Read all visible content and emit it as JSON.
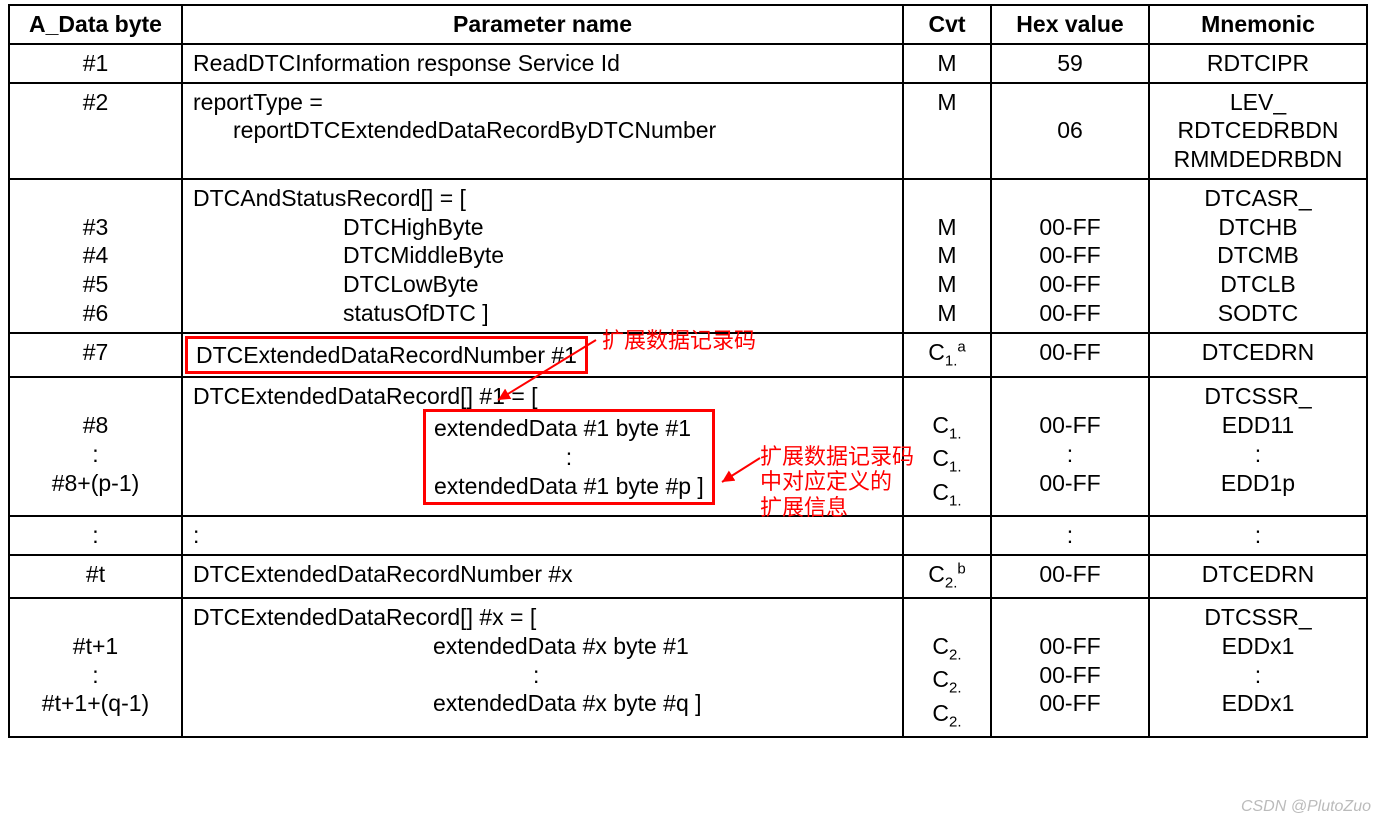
{
  "headers": {
    "col1": "A_Data byte",
    "col2": "Parameter name",
    "col3": "Cvt",
    "col4": "Hex value",
    "col5": "Mnemonic"
  },
  "rows": {
    "r1": {
      "byte": "#1",
      "param": "ReadDTCInformation response Service Id",
      "cvt": "M",
      "hex": "59",
      "mne": "RDTCIPR"
    },
    "r2": {
      "byte": "#2",
      "param_l1": "reportType =",
      "param_l2": "reportDTCExtendedDataRecordByDTCNumber",
      "cvt": "M",
      "hex": "06",
      "mne_l1": "LEV_",
      "mne_l2": "RDTCEDRBDN",
      "mne_l3": "RMMDEDRBDN"
    },
    "r3": {
      "byte_l1": "#3",
      "byte_l2": "#4",
      "byte_l3": "#5",
      "byte_l4": "#6",
      "param_l0": "DTCAndStatusRecord[] = [",
      "param_l1": "DTCHighByte",
      "param_l2": "DTCMiddleByte",
      "param_l3": "DTCLowByte",
      "param_l4": "statusOfDTC ]",
      "cvt_l1": "M",
      "cvt_l2": "M",
      "cvt_l3": "M",
      "cvt_l4": "M",
      "hex_l1": "00-FF",
      "hex_l2": "00-FF",
      "hex_l3": "00-FF",
      "hex_l4": "00-FF",
      "mne_l0": "DTCASR_",
      "mne_l1": "DTCHB",
      "mne_l2": "DTCMB",
      "mne_l3": "DTCLB",
      "mne_l4": "SODTC"
    },
    "r4": {
      "byte": "#7",
      "param": "DTCExtendedDataRecordNumber #1",
      "cvt_html": "C<span class='sub'>1.</span><span class='sup'>a</span>",
      "hex": "00-FF",
      "mne": "DTCEDRN"
    },
    "r5": {
      "byte_l1": "#8",
      "byte_l2": ":",
      "byte_l3": "#8+(p-1)",
      "param_l0": "DTCExtendedDataRecord[] #1 = [",
      "param_l1": "extendedData #1 byte #1",
      "param_l2": ":",
      "param_l3": "extendedData #1 byte #p ]",
      "cvt_l1_html": "C<span class='sub'>1.</span>",
      "cvt_l2_html": "C<span class='sub'>1.</span>",
      "cvt_l3_html": "C<span class='sub'>1.</span>",
      "hex_l1": "00-FF",
      "hex_l2": ":",
      "hex_l3": "00-FF",
      "mne_l0": "DTCSSR_",
      "mne_l1": "EDD11",
      "mne_l2": ":",
      "mne_l3": "EDD1p"
    },
    "r6": {
      "byte": ":",
      "param": ":",
      "cvt": "",
      "hex": ":",
      "mne": ":"
    },
    "r7": {
      "byte": "#t",
      "param": "DTCExtendedDataRecordNumber #x",
      "cvt_html": "C<span class='sub'>2.</span><span class='sup'>b</span>",
      "hex": "00-FF",
      "mne": "DTCEDRN"
    },
    "r8": {
      "byte_l1": "#t+1",
      "byte_l2": ":",
      "byte_l3": "#t+1+(q-1)",
      "param_l0": "DTCExtendedDataRecord[] #x = [",
      "param_l1": "extendedData #x byte #1",
      "param_l2": ":",
      "param_l3": "extendedData #x byte #q ]",
      "cvt_l1_html": "C<span class='sub'>2.</span>",
      "cvt_l2_html": "C<span class='sub'>2.</span>",
      "cvt_l3_html": "C<span class='sub'>2.</span>",
      "hex_l1": "00-FF",
      "hex_l2": "00-FF",
      "hex_l3": "00-FF",
      "mne_l0": "DTCSSR_",
      "mne_l1": "EDDx1",
      "mne_l2": ":",
      "mne_l3": "EDDx1"
    }
  },
  "anno": {
    "a1": "扩展数据记录码",
    "a2_l1": "扩展数据记录码",
    "a2_l2": "中对应定义的",
    "a2_l3": "扩展信息"
  },
  "watermark": "CSDN @PlutoZuo"
}
